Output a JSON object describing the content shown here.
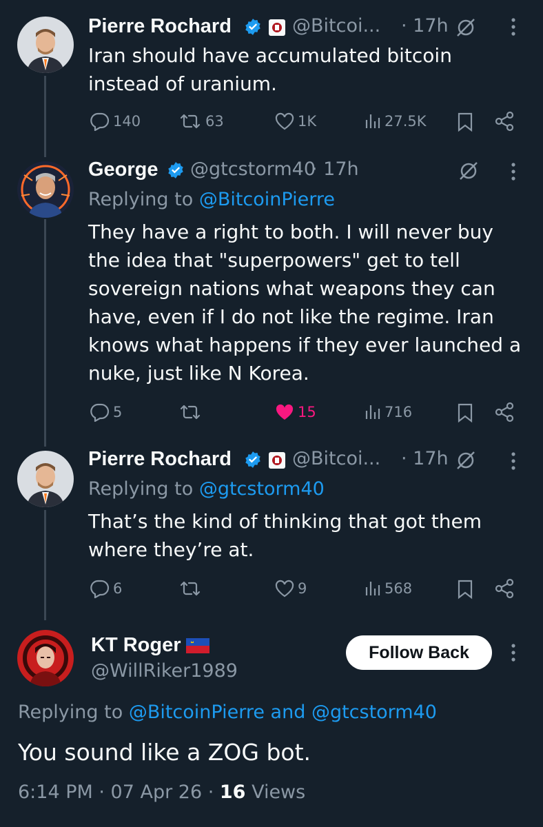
{
  "tweets": [
    {
      "name": "Pierre Rochard",
      "handle": "@Bitcoi...",
      "time": "· 17h",
      "text": "Iran should have accumulated bitcoin instead of uranium.",
      "stats": {
        "replies": "140",
        "reposts": "63",
        "likes": "1K",
        "views": "27.5K"
      }
    },
    {
      "name": "George",
      "handle": "@gtcstorm40",
      "time": "· 17h",
      "replying_to_label": "Replying to",
      "replying_to": "@BitcoinPierre",
      "text": "They have a right to both. I will never buy the idea that \"superpowers\" get to tell sovereign nations what weapons they can have, even if I do not like the regime. Iran knows what happens if they ever launched a nuke, just like N Korea.",
      "stats": {
        "replies": "5",
        "reposts": "",
        "likes": "15",
        "views": "716"
      }
    },
    {
      "name": "Pierre Rochard",
      "handle": "@Bitcoi...",
      "time": "· 17h",
      "replying_to_label": "Replying to",
      "replying_to": "@gtcstorm40",
      "text": "That’s the kind of thinking that got them where they’re at.",
      "stats": {
        "replies": "6",
        "reposts": "",
        "likes": "9",
        "views": "568"
      }
    }
  ],
  "main_tweet": {
    "name": "KT Roger",
    "handle": "@WillRiker1989",
    "follow_button": "Follow Back",
    "replying_to_label": "Replying to",
    "mention_1": "@BitcoinPierre",
    "and_label": "and",
    "mention_2": "@gtcstorm40",
    "text": "You sound like a ZOG bot.",
    "timestamp": "6:14 PM · 07 Apr 26 ·",
    "views_count": "16",
    "views_label": "Views"
  },
  "colors": {
    "background": "#15202b",
    "accent": "#1d9bf0",
    "like": "#f91880",
    "muted": "#8b98a5"
  }
}
